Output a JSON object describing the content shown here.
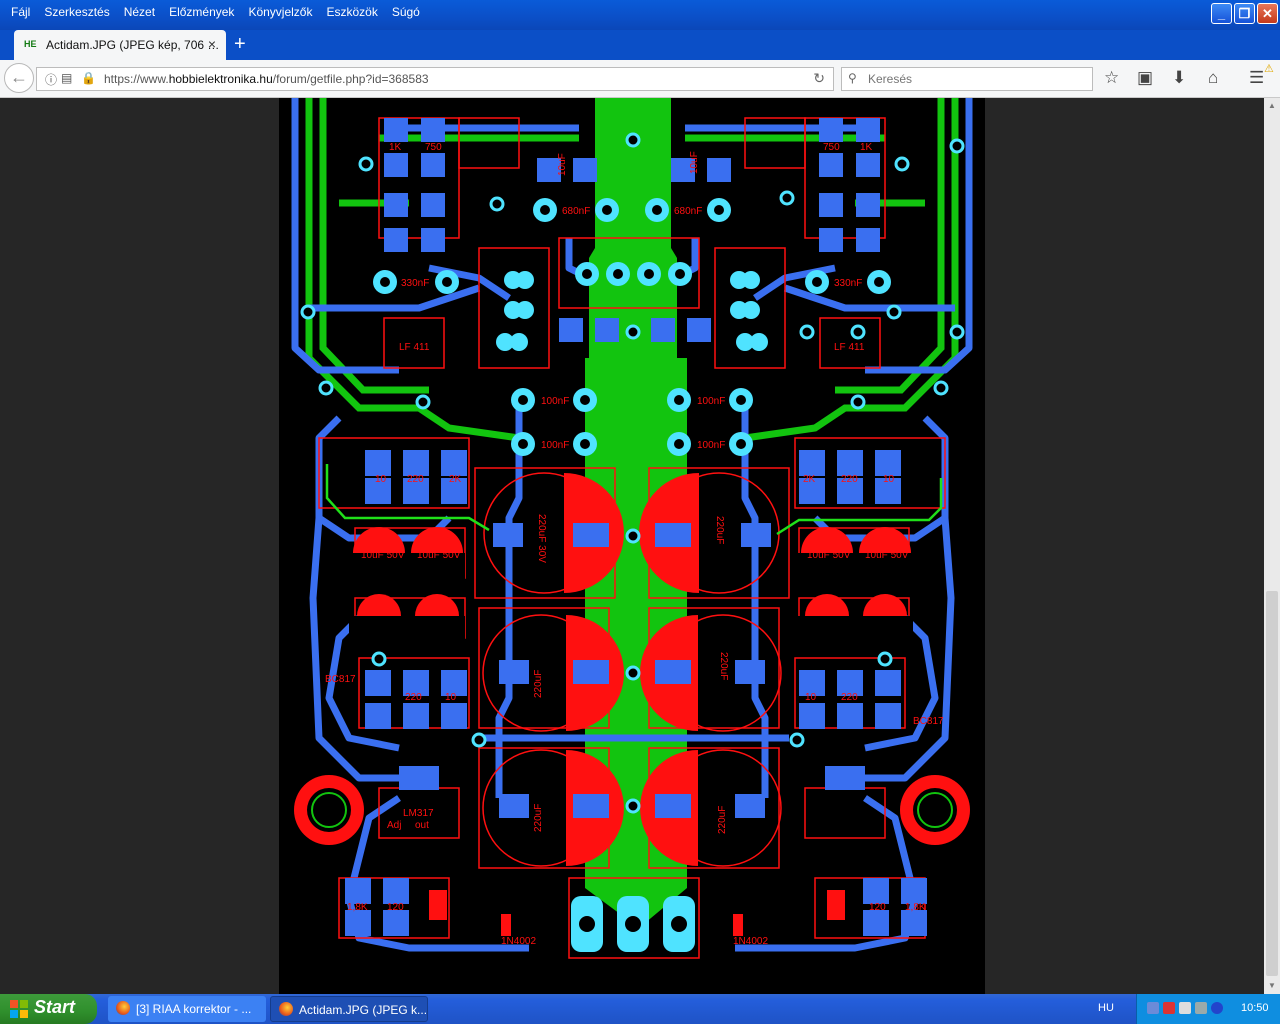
{
  "window": {
    "menu": [
      "Fájl",
      "Szerkesztés",
      "Nézet",
      "Előzmények",
      "Könyvjelzők",
      "Eszközök",
      "Súgó"
    ]
  },
  "tab": {
    "favicon": "HE",
    "title": "Actidam.JPG (JPEG kép, 706 …"
  },
  "navbar": {
    "url_prefix": "https://www.",
    "url_domain": "hobbielektronika.hu",
    "url_path": "/forum/getfile.php?id=368583",
    "search_placeholder": "Keresés"
  },
  "image": {
    "texts": {
      "r1k_l": "1K",
      "r750_l": "750",
      "r1k_r": "1K",
      "r750_r": "750",
      "c10uf_l": "10uF",
      "c10uf_r": "10uF",
      "c680_l": "680nF",
      "c680_r": "680nF",
      "c330_l": "330nF",
      "c330_r": "330nF",
      "lf411_l": "LF 411",
      "lf411_r": "LF 411",
      "c100a_l": "100nF",
      "c100a_r": "100nF",
      "c100b_l": "100nF",
      "c100b_r": "100nF",
      "r10_l": "10",
      "r220_l": "220",
      "r2k_l": "2K",
      "r2k_r": "2K",
      "r220_r": "220",
      "r10_r": "10",
      "e220_30_l": "220uF 30V",
      "e220_30_r": "220uF",
      "e220a_l": "220uF",
      "e220a_r": "220uF",
      "e220b_l": "220uF",
      "e220b_r": "220uF",
      "c10u50a": "10uF 50V",
      "c10u50b": "10uF 50V",
      "c10u50c": "10uF 50V",
      "c10u50d": "10uF 50V",
      "bc817_l": "BC817",
      "bc817_r": "BC817",
      "r10b_l": "10",
      "r220b_l": "220",
      "r10b_r": "10",
      "r220b_r": "220",
      "lm317": "LM317",
      "adj": "Adj",
      "out": "out",
      "r18k_l": "1,8K",
      "r120_l": "120",
      "r120_r": "120",
      "r18k_r": "1,8K",
      "d1": "1N4002",
      "d2": "1N4002"
    }
  },
  "taskbar": {
    "start_label": "Start",
    "task1": "[3] RIAA korrektor - ...",
    "task2": "Actidam.JPG (JPEG k...",
    "lang": "HU",
    "clock": "10:50"
  },
  "colors": {
    "pcb_bg": "#000000",
    "copper_top": "#3a6ff0",
    "copper_bottom": "#12c40f",
    "silk": "#ff1010",
    "via": "#4fe3ff",
    "firefox_blue": "#0b4fc7",
    "taskbar": "#245edb",
    "start": "#2f8f2c"
  }
}
